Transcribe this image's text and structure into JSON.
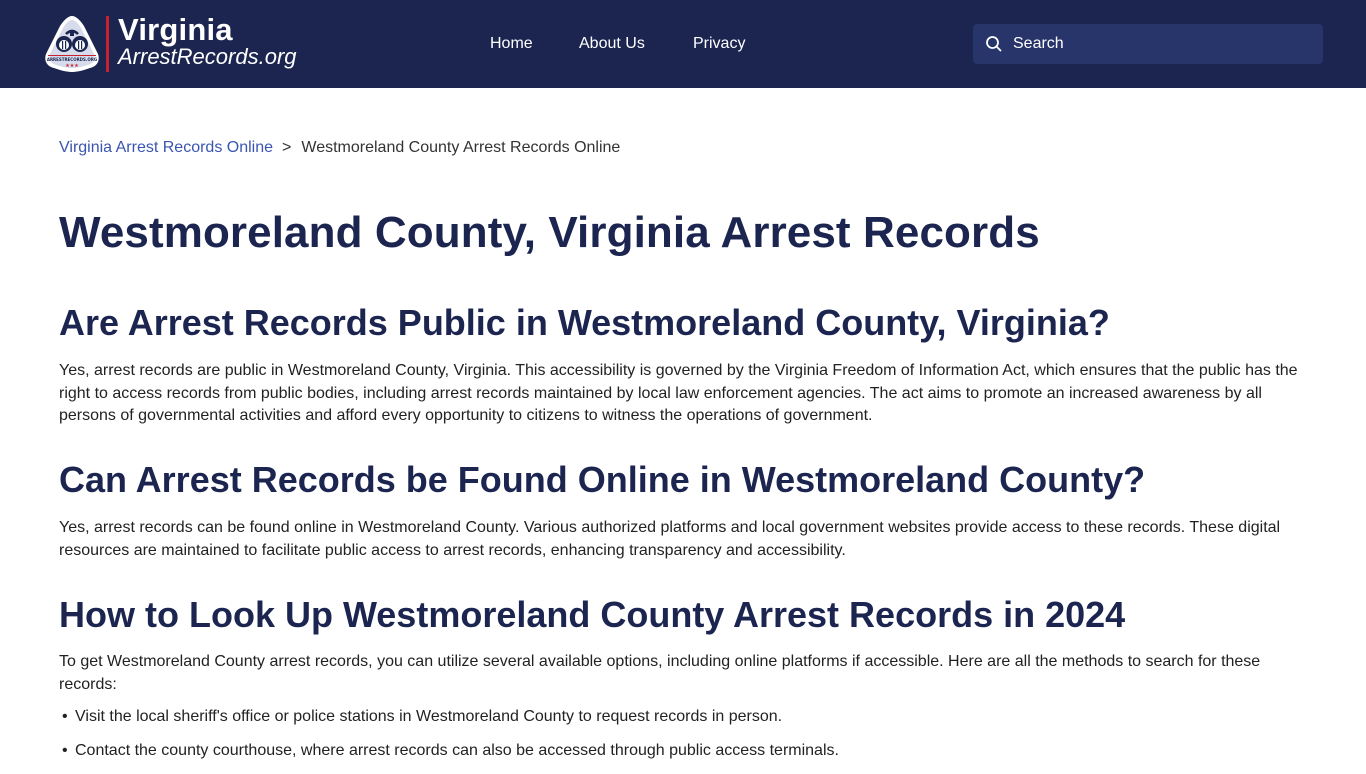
{
  "header": {
    "logo": {
      "line1": "Virginia",
      "line2": "ArrestRecords.org",
      "badge_text": "ARRESTRECORDS.ORG",
      "badge_stars": "★★★"
    },
    "nav": [
      {
        "label": "Home"
      },
      {
        "label": "About Us"
      },
      {
        "label": "Privacy"
      }
    ],
    "search": {
      "placeholder": "Search",
      "value": "",
      "icon": "search-icon"
    }
  },
  "breadcrumb": {
    "parent": "Virginia Arrest Records Online",
    "separator": ">",
    "current": "Westmoreland County Arrest Records Online"
  },
  "page": {
    "title": "Westmoreland County, Virginia Arrest Records",
    "sections": [
      {
        "heading": "Are Arrest Records Public in Westmoreland County, Virginia?",
        "text": "Yes, arrest records are public in Westmoreland County, Virginia. This accessibility is governed by the Virginia Freedom of Information Act, which ensures that the public has the right to access records from public bodies, including arrest records maintained by local law enforcement agencies. The act aims to promote an increased awareness by all persons of governmental activities and afford every opportunity to citizens to witness the operations of government."
      },
      {
        "heading": "Can Arrest Records be Found Online in Westmoreland County?",
        "text": "Yes, arrest records can be found online in Westmoreland County. Various authorized platforms and local government websites provide access to these records. These digital resources are maintained to facilitate public access to arrest records, enhancing transparency and accessibility."
      },
      {
        "heading": "How to Look Up Westmoreland County Arrest Records in 2024",
        "text": "To get Westmoreland County arrest records, you can utilize several available options, including online platforms if accessible. Here are all the methods to search for these records:",
        "bullets": [
          "Visit the local sheriff's office or police stations in Westmoreland County to request records in person.",
          "Contact the county courthouse, where arrest records can also be accessed through public access terminals."
        ]
      }
    ]
  },
  "colors": {
    "header_bg": "#1b2550",
    "search_bg": "#27356b",
    "heading": "#1b2550",
    "link": "#3a55b0",
    "accent_red": "#c8202f"
  }
}
